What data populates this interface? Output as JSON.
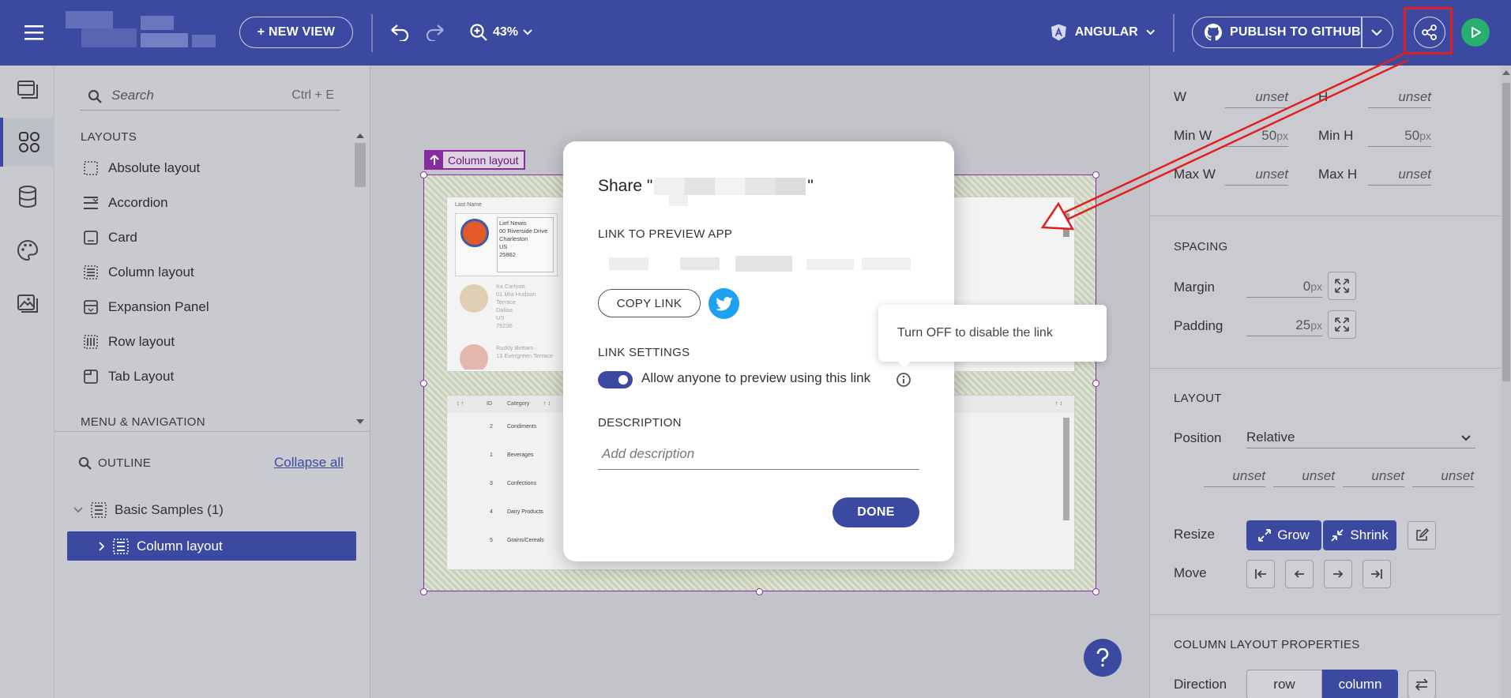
{
  "topbar": {
    "new_view_label": "+ NEW VIEW",
    "zoom_level": "43%",
    "framework_label": "ANGULAR",
    "publish_label": "PUBLISH TO GITHUB"
  },
  "components": {
    "search_placeholder": "Search",
    "search_shortcut": "Ctrl + E",
    "layouts_title": "LAYOUTS",
    "items": [
      {
        "label": "Absolute layout",
        "icon": "absolute-layout-icon"
      },
      {
        "label": "Accordion",
        "icon": "accordion-icon"
      },
      {
        "label": "Card",
        "icon": "card-icon"
      },
      {
        "label": "Column layout",
        "icon": "column-layout-icon"
      },
      {
        "label": "Expansion Panel",
        "icon": "expansion-panel-icon"
      },
      {
        "label": "Row layout",
        "icon": "row-layout-icon"
      },
      {
        "label": "Tab Layout",
        "icon": "tab-layout-icon"
      }
    ],
    "menu_nav_title": "MENU & NAVIGATION"
  },
  "outline": {
    "title": "OUTLINE",
    "collapse_label": "Collapse all",
    "tree": [
      {
        "label": "Basic Samples (1)"
      },
      {
        "label": "Column layout",
        "selected": true
      }
    ]
  },
  "canvas": {
    "selection_tag": "Column layout",
    "mini_grid_header": "Last Name",
    "mini_cards": [
      {
        "name": "Lief Newis",
        "address": "00 Riverside Drive",
        "city": "Charleston",
        "country": "US",
        "zip": "25862"
      },
      {
        "name": "Ira Carlyon",
        "address": "01 Mia Hudson Terrace",
        "city": "Dallas",
        "country": "US",
        "zip": "75236"
      },
      {
        "name": "Ruddy Bettam",
        "address": "13 Evergreen Terrace",
        "city": "",
        "country": "",
        "zip": ""
      }
    ],
    "mini_table": {
      "headers": [
        "ID",
        "Category"
      ],
      "rows": [
        [
          "2",
          "Condiments"
        ],
        [
          "1",
          "Beverages"
        ],
        [
          "3",
          "Confections"
        ],
        [
          "4",
          "Dairy Products"
        ],
        [
          "5",
          "Grains/Cereals"
        ]
      ]
    }
  },
  "modal": {
    "title_prefix": "Share \"",
    "title_suffix": "\"",
    "preview_link_title": "LINK TO PREVIEW APP",
    "copy_link_label": "COPY LINK",
    "link_settings_title": "LINK SETTINGS",
    "toggle_label": "Allow anyone to preview using this link",
    "toggle_on": true,
    "description_title": "DESCRIPTION",
    "description_placeholder": "Add description",
    "done_label": "DONE"
  },
  "tooltip": {
    "text": "Turn OFF to disable the link"
  },
  "props": {
    "size": {
      "w_label": "W",
      "w_value": "unset",
      "h_label": "H",
      "h_value": "unset",
      "minw_label": "Min W",
      "minw_value": "50",
      "minh_label": "Min H",
      "minh_value": "50",
      "maxw_label": "Max W",
      "maxw_value": "unset",
      "maxh_label": "Max H",
      "maxh_value": "unset",
      "unit": "px"
    },
    "spacing": {
      "title": "SPACING",
      "margin_label": "Margin",
      "margin_value": "0",
      "padding_label": "Padding",
      "padding_value": "25",
      "unit": "px"
    },
    "layout": {
      "title": "LAYOUT",
      "position_label": "Position",
      "position_value": "Relative",
      "offsets": [
        "unset",
        "unset",
        "unset",
        "unset"
      ],
      "resize_label": "Resize",
      "grow_label": "Grow",
      "shrink_label": "Shrink",
      "move_label": "Move"
    },
    "column_layout": {
      "title": "COLUMN LAYOUT PROPERTIES",
      "direction_label": "Direction",
      "direction_options": [
        "row",
        "column"
      ],
      "direction_selected": "column"
    }
  },
  "colors": {
    "brand": "#3b4aa0",
    "annotation": "#e02020",
    "twitter": "#1da1f2",
    "selection": "#8a2aa0"
  }
}
